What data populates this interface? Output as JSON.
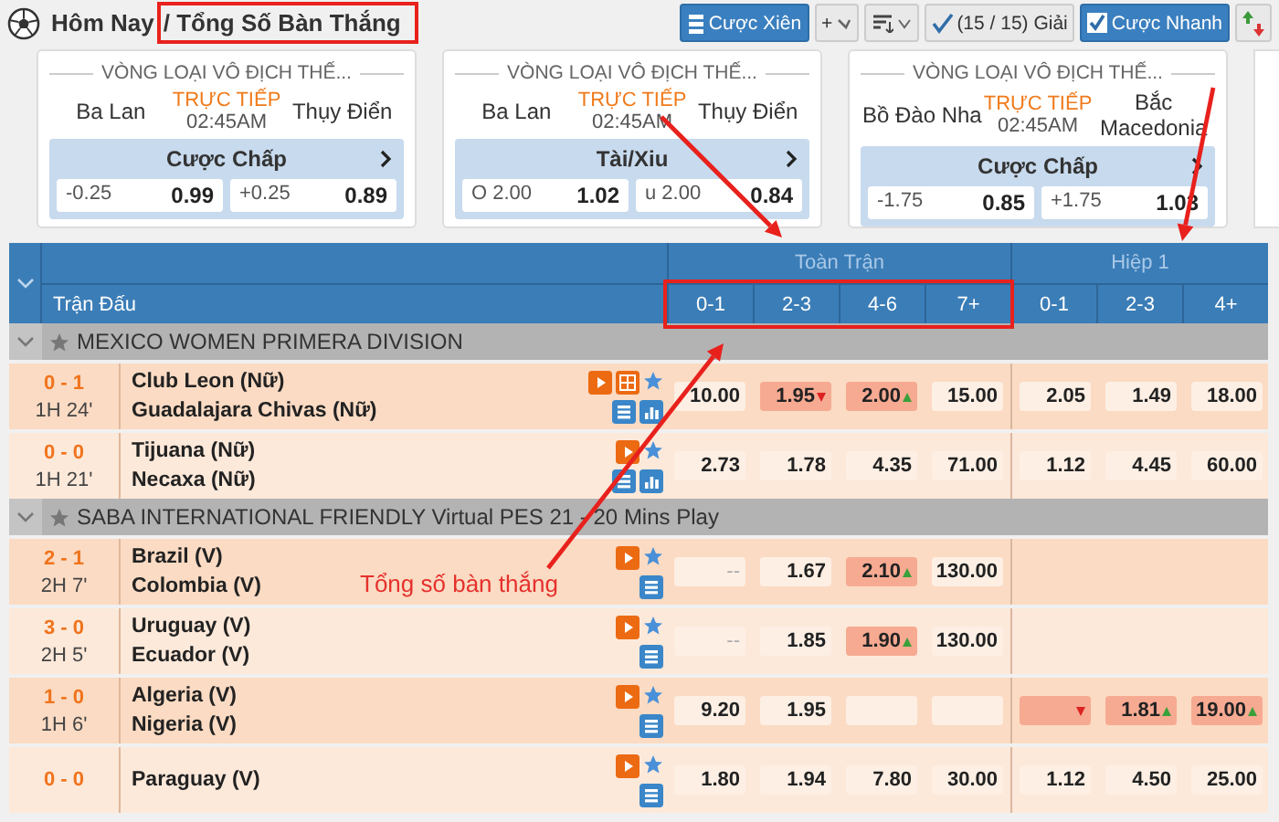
{
  "header": {
    "breadcrumb": {
      "parent": "Hôm Nay",
      "separator": "/",
      "current": "Tổng Số Bàn Thắng"
    },
    "toolbar": [
      {
        "kind": "parlay",
        "label": "Cược Xiên"
      },
      {
        "kind": "add",
        "label": "+"
      },
      {
        "kind": "sort"
      },
      {
        "kind": "filter",
        "label": "(15 / 15) Giải"
      },
      {
        "kind": "checkbox",
        "label": "Cược Nhanh",
        "checked": true
      },
      {
        "kind": "updown"
      }
    ]
  },
  "featured": [
    {
      "league": "VÒNG LOẠI VÔ ĐỊCH THẾ...",
      "home": "Ba Lan",
      "status": "TRỰC TIẾP",
      "time": "02:45AM",
      "away": "Thụy Điển",
      "market": "Cược Chấp",
      "odds": [
        {
          "line": "-0.25",
          "price": "0.99"
        },
        {
          "line": "+0.25",
          "price": "0.89"
        }
      ]
    },
    {
      "league": "VÒNG LOẠI VÔ ĐỊCH THẾ...",
      "home": "Ba Lan",
      "status": "TRỰC TIẾP",
      "time": "02:45AM",
      "away": "Thụy Điển",
      "market": "Tài/Xiu",
      "odds": [
        {
          "line": "O 2.00",
          "price": "1.02"
        },
        {
          "line": "u 2.00",
          "price": "0.84"
        }
      ]
    },
    {
      "league": "VÒNG LOẠI VÔ ĐỊCH THẾ...",
      "home": "Bồ Đào Nha",
      "status": "TRỰC TIẾP",
      "time": "02:45AM",
      "away": "Bắc Macedonia",
      "market": "Cược Chấp",
      "odds": [
        {
          "line": "-1.75",
          "price": "0.85"
        },
        {
          "line": "+1.75",
          "price": "1.03"
        }
      ]
    }
  ],
  "table": {
    "match_label": "Trận Đấu",
    "groups": [
      {
        "title": "Toàn Trận",
        "columns": [
          "0-1",
          "2-3",
          "4-6",
          "7+"
        ]
      },
      {
        "title": "Hiệp 1",
        "columns": [
          "0-1",
          "2-3",
          "4+"
        ]
      }
    ],
    "leagues": [
      {
        "name": "MEXICO WOMEN PRIMERA DIVISION",
        "matches": [
          {
            "score": "0 - 1",
            "period": "1H 24'",
            "home": "Club Leon (Nữ)",
            "away": "Guadalajara Chivas (Nữ)",
            "animation": true,
            "stats": true,
            "full_time": [
              {
                "value": "10.00",
                "highlight": false,
                "rise": false,
                "fall": false
              },
              {
                "value": "1.95",
                "highlight": true,
                "rise": false,
                "fall": true
              },
              {
                "value": "2.00",
                "highlight": true,
                "rise": true,
                "fall": false
              },
              {
                "value": "15.00",
                "highlight": false,
                "rise": false,
                "fall": false
              }
            ],
            "first_half": [
              {
                "value": "2.05",
                "highlight": false,
                "rise": false,
                "fall": false
              },
              {
                "value": "1.49",
                "highlight": false,
                "rise": false,
                "fall": false
              },
              {
                "value": "18.00",
                "highlight": false,
                "rise": false,
                "fall": false
              }
            ]
          },
          {
            "score": "0 - 0",
            "period": "1H 21'",
            "home": "Tijuana (Nữ)",
            "away": "Necaxa (Nữ)",
            "animation": false,
            "stats": true,
            "full_time": [
              {
                "value": "2.73",
                "highlight": false,
                "rise": false,
                "fall": false
              },
              {
                "value": "1.78",
                "highlight": false,
                "rise": false,
                "fall": false
              },
              {
                "value": "4.35",
                "highlight": false,
                "rise": false,
                "fall": false
              },
              {
                "value": "71.00",
                "highlight": false,
                "rise": false,
                "fall": false
              }
            ],
            "first_half": [
              {
                "value": "1.12",
                "highlight": false,
                "rise": false,
                "fall": false
              },
              {
                "value": "4.45",
                "highlight": false,
                "rise": false,
                "fall": false
              },
              {
                "value": "60.00",
                "highlight": false,
                "rise": false,
                "fall": false
              }
            ]
          }
        ]
      },
      {
        "name": "SABA INTERNATIONAL FRIENDLY Virtual PES 21 - 20 Mins Play",
        "matches": [
          {
            "score": "2 - 1",
            "period": "2H 7'",
            "home": "Brazil (V)",
            "away": "Colombia (V)",
            "animation": false,
            "stats": false,
            "full_time": [
              {
                "value": "--",
                "highlight": false,
                "rise": false,
                "fall": false
              },
              {
                "value": "1.67",
                "highlight": false,
                "rise": false,
                "fall": false
              },
              {
                "value": "2.10",
                "highlight": true,
                "rise": true,
                "fall": false
              },
              {
                "value": "130.00",
                "highlight": false,
                "rise": false,
                "fall": false
              }
            ]
          },
          {
            "score": "3 - 0",
            "period": "2H 5'",
            "home": "Uruguay (V)",
            "away": "Ecuador (V)",
            "animation": false,
            "stats": false,
            "full_time": [
              {
                "value": "--",
                "highlight": false,
                "rise": false,
                "fall": false
              },
              {
                "value": "1.85",
                "highlight": false,
                "rise": false,
                "fall": false
              },
              {
                "value": "1.90",
                "highlight": true,
                "rise": true,
                "fall": false
              },
              {
                "value": "130.00",
                "highlight": false,
                "rise": false,
                "fall": false
              }
            ]
          },
          {
            "score": "1 - 0",
            "period": "1H 6'",
            "home": "Algeria (V)",
            "away": "Nigeria (V)",
            "animation": false,
            "stats": false,
            "full_time": [
              {
                "value": "9.20",
                "highlight": false,
                "rise": false,
                "fall": false
              },
              {
                "value": "1.95",
                "highlight": false,
                "rise": false,
                "fall": false
              },
              {
                "highlight": false,
                "rise": false,
                "fall": false
              },
              {
                "highlight": false,
                "rise": false,
                "fall": false
              }
            ],
            "first_half": [
              {
                "highlight": true,
                "rise": false,
                "fall": true
              },
              {
                "value": "1.81",
                "highlight": true,
                "rise": true,
                "fall": false
              },
              {
                "value": "19.00",
                "highlight": true,
                "rise": true,
                "fall": false
              }
            ]
          },
          {
            "score": "0 - 0",
            "home": "Paraguay (V)",
            "animation": false,
            "stats": false,
            "full_time": [
              {
                "value": "1.80",
                "highlight": false,
                "rise": false,
                "fall": false
              },
              {
                "value": "1.94",
                "highlight": false,
                "rise": false,
                "fall": false
              },
              {
                "value": "7.80",
                "highlight": false,
                "rise": false,
                "fall": false
              },
              {
                "value": "30.00",
                "highlight": false,
                "rise": false,
                "fall": false
              }
            ],
            "first_half": [
              {
                "value": "1.12",
                "highlight": false,
                "rise": false,
                "fall": false
              },
              {
                "value": "4.50",
                "highlight": false,
                "rise": false,
                "fall": false
              },
              {
                "value": "25.00",
                "highlight": false,
                "rise": false,
                "fall": false
              }
            ]
          }
        ]
      }
    ]
  },
  "annotation": {
    "label": "Tổng số bàn thắng"
  }
}
